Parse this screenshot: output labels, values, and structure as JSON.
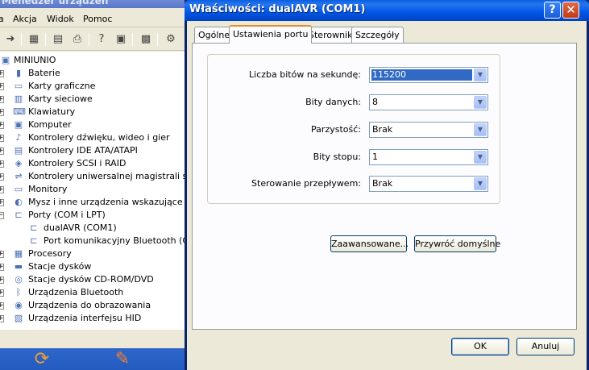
{
  "device_manager": {
    "title": "Menedżer urządzeń",
    "menu": [
      "Akcja",
      "Widok",
      "Pomoc"
    ],
    "toolbar_icons": [
      "forward-arrow-icon",
      "tree-view-icon",
      "properties-icon",
      "print-icon",
      "help-icon",
      "console-tree-icon",
      "computer-icon",
      "scan-hardware-icon"
    ],
    "tree": {
      "root": "MINIUNIO",
      "items": [
        {
          "label": "Baterie",
          "icon": "battery-icon",
          "expanded": false,
          "level": 1
        },
        {
          "label": "Karty graficzne",
          "icon": "display-adapter-icon",
          "expanded": false,
          "level": 1
        },
        {
          "label": "Karty sieciowe",
          "icon": "network-card-icon",
          "expanded": false,
          "level": 1
        },
        {
          "label": "Klawiatury",
          "icon": "keyboard-icon",
          "expanded": false,
          "level": 1
        },
        {
          "label": "Komputer",
          "icon": "computer-icon",
          "expanded": false,
          "level": 1
        },
        {
          "label": "Kontrolery dźwięku, wideo i gier",
          "icon": "sound-icon",
          "expanded": false,
          "level": 1
        },
        {
          "label": "Kontrolery IDE ATA/ATAPI",
          "icon": "ide-controller-icon",
          "expanded": false,
          "level": 1
        },
        {
          "label": "Kontrolery SCSI i RAID",
          "icon": "scsi-controller-icon",
          "expanded": false,
          "level": 1
        },
        {
          "label": "Kontrolery uniwersalnej magistrali szeregowej",
          "icon": "usb-icon",
          "expanded": false,
          "level": 1
        },
        {
          "label": "Monitory",
          "icon": "monitor-icon",
          "expanded": false,
          "level": 1
        },
        {
          "label": "Mysz i inne urządzenia wskazujące",
          "icon": "mouse-icon",
          "expanded": false,
          "level": 1
        },
        {
          "label": "Porty (COM i LPT)",
          "icon": "port-icon",
          "expanded": true,
          "level": 1
        },
        {
          "label": "dualAVR (COM1)",
          "icon": "port-device-icon",
          "expanded": null,
          "level": 2
        },
        {
          "label": "Port komunikacyjny Bluetooth (COM",
          "icon": "port-device-icon",
          "expanded": null,
          "level": 2
        },
        {
          "label": "Procesory",
          "icon": "processor-icon",
          "expanded": false,
          "level": 1
        },
        {
          "label": "Stacje dysków",
          "icon": "disk-drive-icon",
          "expanded": false,
          "level": 1
        },
        {
          "label": "Stacje dysków CD-ROM/DVD",
          "icon": "cdrom-icon",
          "expanded": false,
          "level": 1
        },
        {
          "label": "Urządzenia Bluetooth",
          "icon": "bluetooth-icon",
          "expanded": false,
          "level": 1
        },
        {
          "label": "Urządzenia do obrazowania",
          "icon": "camera-icon",
          "expanded": false,
          "level": 1
        },
        {
          "label": "Urządzenia interfejsu HID",
          "icon": "hid-icon",
          "expanded": false,
          "level": 1
        }
      ]
    }
  },
  "dialog": {
    "title": "Właściwości: dualAVR (COM1)",
    "help_label": "?",
    "close_label": "✕",
    "tabs": [
      {
        "label": "Ogólne",
        "active": false
      },
      {
        "label": "Ustawienia portu",
        "active": true
      },
      {
        "label": "Sterownik",
        "active": false
      },
      {
        "label": "Szczegóły",
        "active": false
      }
    ],
    "fields": [
      {
        "label": "Liczba bitów na sekundę:",
        "value": "115200",
        "focused": true
      },
      {
        "label": "Bity danych:",
        "value": "8",
        "focused": false
      },
      {
        "label": "Parzystość:",
        "value": "Brak",
        "focused": false
      },
      {
        "label": "Bity stopu:",
        "value": "1",
        "focused": false
      },
      {
        "label": "Sterowanie przepływem:",
        "value": "Brak",
        "focused": false
      }
    ],
    "advanced_button": "Zaawansowane...",
    "restore_button": "Przywróć domyślne",
    "ok_button": "OK",
    "cancel_button": "Anuluj"
  },
  "colors": {
    "titlebar": "#0055e5",
    "selection": "#316ac5",
    "active_tab_accent": "#e68b2c"
  }
}
